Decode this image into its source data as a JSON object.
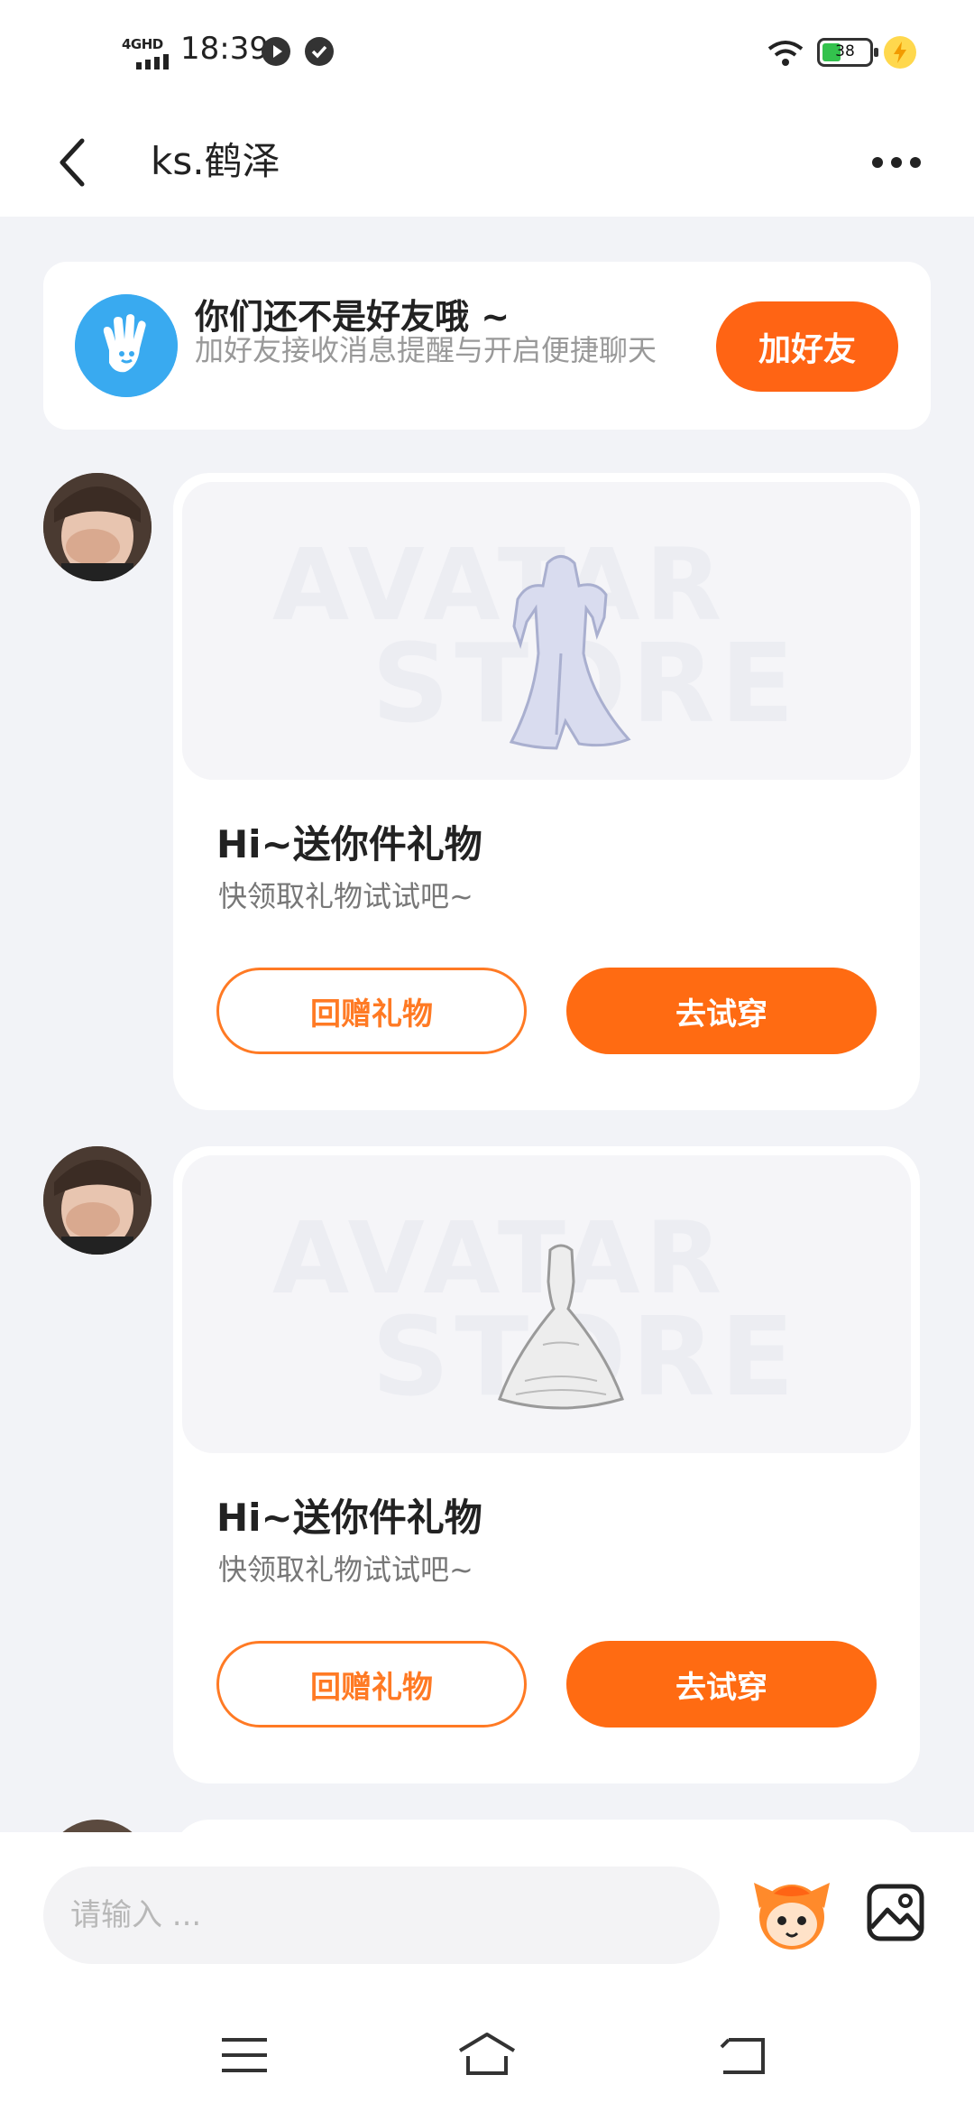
{
  "status_bar": {
    "network": "4GHD",
    "time": "18:39",
    "battery": "38"
  },
  "header": {
    "title": "ks.鹤泽"
  },
  "friend_banner": {
    "title": "你们还不是好友哦 ~",
    "subtitle": "加好友接收消息提醒与开启便捷聊天",
    "add_button": "加好友"
  },
  "messages": [
    {
      "watermark_top": "AVATAR",
      "watermark_bottom": "STORE",
      "title": "Hi~送你件礼物",
      "subtitle": "快领取礼物试试吧~",
      "gift_button": "回赠礼物",
      "try_button": "去试穿"
    },
    {
      "watermark_top": "AVATAR",
      "watermark_bottom": "STORE",
      "title": "Hi~送你件礼物",
      "subtitle": "快领取礼物试试吧~",
      "gift_button": "回赠礼物",
      "try_button": "去试穿"
    }
  ],
  "input": {
    "placeholder": "请输入 ..."
  },
  "colors": {
    "accent": "#ff6414",
    "banner_icon": "#39aaf0"
  }
}
